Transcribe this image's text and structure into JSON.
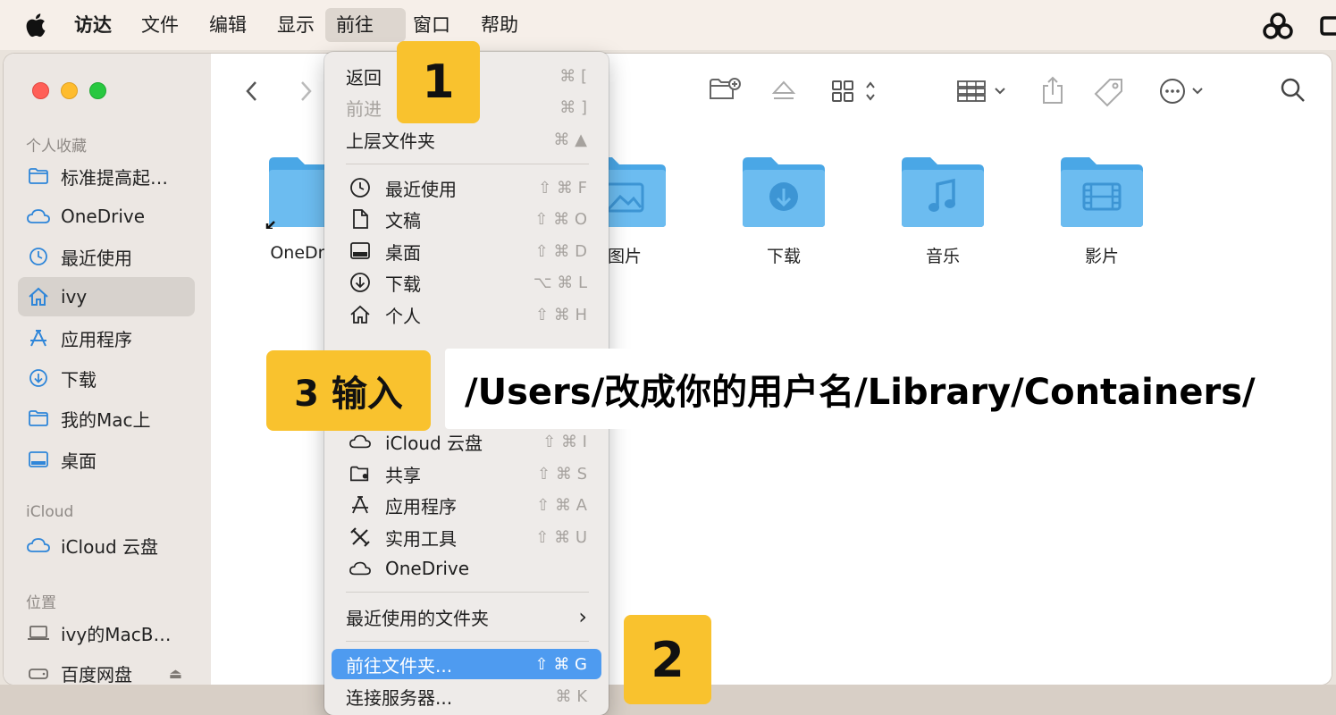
{
  "menubar": {
    "app": "访达",
    "items": [
      "文件",
      "编辑",
      "显示",
      "前往",
      "窗口",
      "帮助"
    ],
    "active": "前往"
  },
  "sidebar": {
    "favorites_title": "个人收藏",
    "favorites": [
      {
        "label": "标准提高起…",
        "icon": "folder-icon"
      },
      {
        "label": "OneDrive",
        "icon": "cloud-icon"
      },
      {
        "label": "最近使用",
        "icon": "clock-icon"
      },
      {
        "label": "ivy",
        "icon": "home-icon",
        "selected": true
      },
      {
        "label": "应用程序",
        "icon": "apps-icon"
      },
      {
        "label": "下载",
        "icon": "download-icon"
      },
      {
        "label": "我的Mac上",
        "icon": "folder-icon"
      },
      {
        "label": "桌面",
        "icon": "desktop-icon"
      }
    ],
    "icloud_title": "iCloud",
    "icloud": [
      {
        "label": "iCloud 云盘",
        "icon": "cloud-icon"
      }
    ],
    "locations_title": "位置",
    "locations": [
      {
        "label": "ivy的MacB…",
        "icon": "laptop-icon"
      },
      {
        "label": "百度网盘",
        "icon": "drive-icon",
        "eject": "⏏"
      }
    ]
  },
  "folders": [
    {
      "name": "OneDrive",
      "icon": "folder-alias"
    },
    {
      "name": "图片",
      "icon": "photo-icon"
    },
    {
      "name": "下载",
      "icon": "download-icon"
    },
    {
      "name": "音乐",
      "icon": "music-icon"
    },
    {
      "name": "影片",
      "icon": "film-icon"
    }
  ],
  "go_menu": {
    "items": [
      {
        "label": "返回",
        "shortcut": "⌘ ["
      },
      {
        "label": "前进",
        "shortcut": "⌘ ]",
        "disabled": true
      },
      {
        "label": "上层文件夹",
        "shortcut": "⌘ ▲"
      },
      {
        "label": "最近使用",
        "shortcut": "⇧ ⌘ F",
        "icon": "clock-icon"
      },
      {
        "label": "文稿",
        "shortcut": "⇧ ⌘ O",
        "icon": "document-icon"
      },
      {
        "label": "桌面",
        "shortcut": "⇧ ⌘ D",
        "icon": "desktop-icon"
      },
      {
        "label": "下载",
        "shortcut": "⌥ ⌘ L",
        "icon": "download-icon"
      },
      {
        "label": "个人",
        "shortcut": "⇧ ⌘ H",
        "icon": "home-icon"
      },
      {
        "label": "iCloud 云盘",
        "shortcut": "⇧ ⌘ I",
        "icon": "cloud-icon"
      },
      {
        "label": "共享",
        "shortcut": "⇧ ⌘ S",
        "icon": "shared-folder-icon"
      },
      {
        "label": "应用程序",
        "shortcut": "⇧ ⌘ A",
        "icon": "apps-icon"
      },
      {
        "label": "实用工具",
        "shortcut": "⇧ ⌘ U",
        "icon": "tools-icon"
      },
      {
        "label": "OneDrive",
        "shortcut": "",
        "icon": "cloud-icon"
      },
      {
        "label": "最近使用的文件夹",
        "shortcut": "›"
      },
      {
        "label": "前往文件夹...",
        "shortcut": "⇧ ⌘ G",
        "highlighted": true
      },
      {
        "label": "连接服务器...",
        "shortcut": "⌘ K"
      }
    ]
  },
  "annotations": {
    "step1": "1",
    "step2": "2",
    "step3": "3 输入",
    "path": "/Users/改成你的用户名/Library/Containers/"
  },
  "colors": {
    "highlight": "#4e9bf0",
    "badge": "#f9c22e",
    "folder": "#5fb3ec"
  }
}
